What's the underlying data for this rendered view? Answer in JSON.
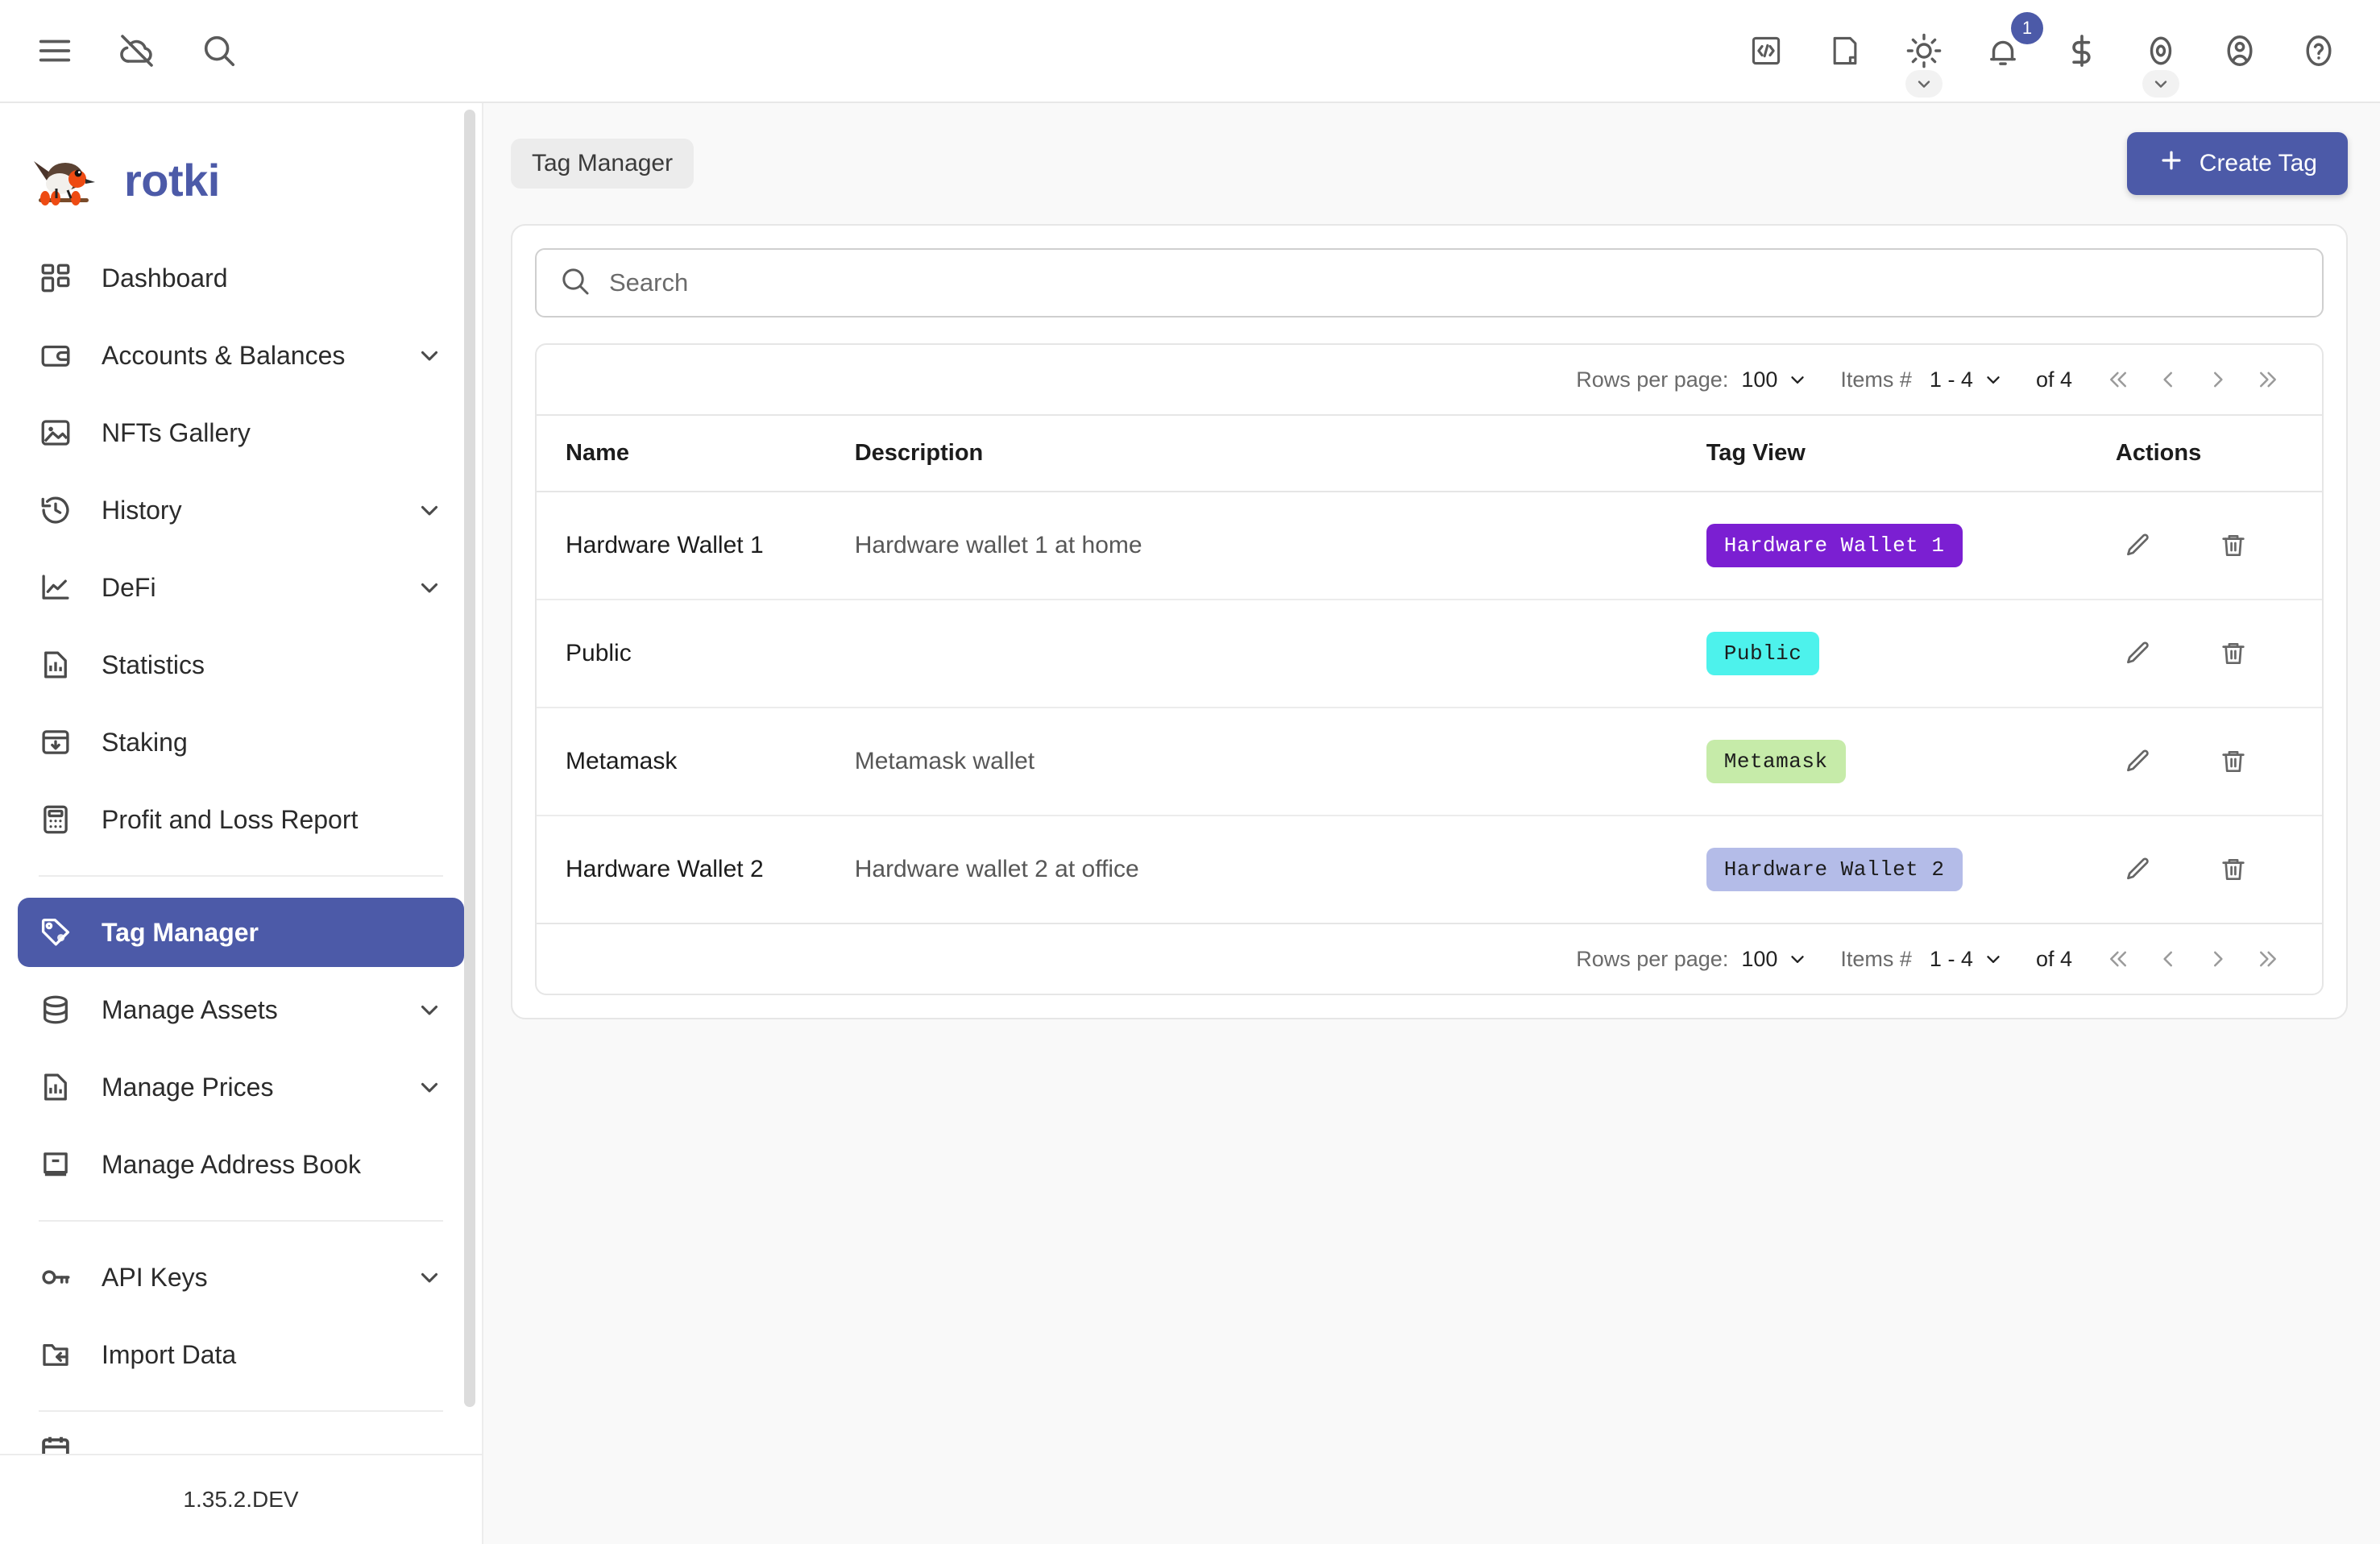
{
  "app": {
    "brand": "rotki",
    "version": "1.35.2.DEV"
  },
  "topbar": {
    "left_icons": [
      {
        "name": "menu-icon",
        "label": "Menu"
      },
      {
        "name": "cloud-off-icon",
        "label": "Cloud sync off"
      },
      {
        "name": "search-icon",
        "label": "Search"
      }
    ],
    "right_icons": [
      {
        "name": "code-icon",
        "label": "Developer"
      },
      {
        "name": "notes-icon",
        "label": "Notes"
      },
      {
        "name": "sun-icon",
        "label": "Theme"
      },
      {
        "name": "bell-icon",
        "label": "Notifications"
      },
      {
        "name": "dollar-icon",
        "label": "Currency"
      },
      {
        "name": "eye-icon",
        "label": "Privacy mode"
      },
      {
        "name": "account-icon",
        "label": "Account"
      },
      {
        "name": "help-icon",
        "label": "Help"
      }
    ],
    "notification_count": "1"
  },
  "sidebar": {
    "groups": [
      {
        "items": [
          {
            "label": "Dashboard",
            "icon": "dashboard-icon",
            "expandable": false,
            "active": false
          },
          {
            "label": "Accounts & Balances",
            "icon": "wallet-icon",
            "expandable": true,
            "active": false
          },
          {
            "label": "NFTs Gallery",
            "icon": "image-icon",
            "expandable": false,
            "active": false
          },
          {
            "label": "History",
            "icon": "history-icon",
            "expandable": true,
            "active": false
          },
          {
            "label": "DeFi",
            "icon": "chart-line-icon",
            "expandable": true,
            "active": false
          },
          {
            "label": "Statistics",
            "icon": "statistics-icon",
            "expandable": false,
            "active": false
          },
          {
            "label": "Staking",
            "icon": "staking-icon",
            "expandable": false,
            "active": false
          },
          {
            "label": "Profit and Loss Report",
            "icon": "calculator-icon",
            "expandable": false,
            "active": false
          }
        ]
      },
      {
        "items": [
          {
            "label": "Tag Manager",
            "icon": "tag-icon",
            "expandable": false,
            "active": true
          },
          {
            "label": "Manage Assets",
            "icon": "database-icon",
            "expandable": true,
            "active": false
          },
          {
            "label": "Manage Prices",
            "icon": "price-chart-icon",
            "expandable": true,
            "active": false
          },
          {
            "label": "Manage Address Book",
            "icon": "address-book-icon",
            "expandable": false,
            "active": false
          }
        ]
      },
      {
        "items": [
          {
            "label": "API Keys",
            "icon": "key-icon",
            "expandable": true,
            "active": false
          },
          {
            "label": "Import Data",
            "icon": "import-folder-icon",
            "expandable": false,
            "active": false
          }
        ]
      }
    ]
  },
  "main": {
    "breadcrumb": "Tag Manager",
    "create_button": "Create Tag",
    "search": {
      "value": "",
      "placeholder": "Search",
      "icon": "search-icon"
    },
    "pagination": {
      "rows_per_page_label": "Rows per page:",
      "rows_per_page_value": "100",
      "items_label": "Items #",
      "items_range": "1 - 4",
      "of_label": "of 4"
    },
    "table": {
      "columns": [
        "Name",
        "Description",
        "Tag View",
        "Actions"
      ],
      "rows": [
        {
          "name": "Hardware Wallet 1",
          "description": "Hardware wallet 1 at home",
          "tag_label": "Hardware Wallet 1",
          "tag_bg": "#7b1fd2",
          "tag_fg": "#ffffff"
        },
        {
          "name": "Public",
          "description": "",
          "tag_label": "Public",
          "tag_bg": "#4df2ec",
          "tag_fg": "#1c1c1c"
        },
        {
          "name": "Metamask",
          "description": "Metamask wallet",
          "tag_label": "Metamask",
          "tag_bg": "#c6eba9",
          "tag_fg": "#1c1c1c"
        },
        {
          "name": "Hardware Wallet 2",
          "description": "Hardware wallet 2 at office",
          "tag_label": "Hardware Wallet 2",
          "tag_bg": "#b4bce8",
          "tag_fg": "#1c1c1c"
        }
      ],
      "row_actions": [
        {
          "name": "edit-row-button",
          "icon": "pencil-icon"
        },
        {
          "name": "delete-row-button",
          "icon": "trash-icon"
        }
      ]
    }
  },
  "theme": {
    "accent": "#4c5aa8",
    "page_bg": "#f9f9f9",
    "border": "#e6e6e6"
  }
}
